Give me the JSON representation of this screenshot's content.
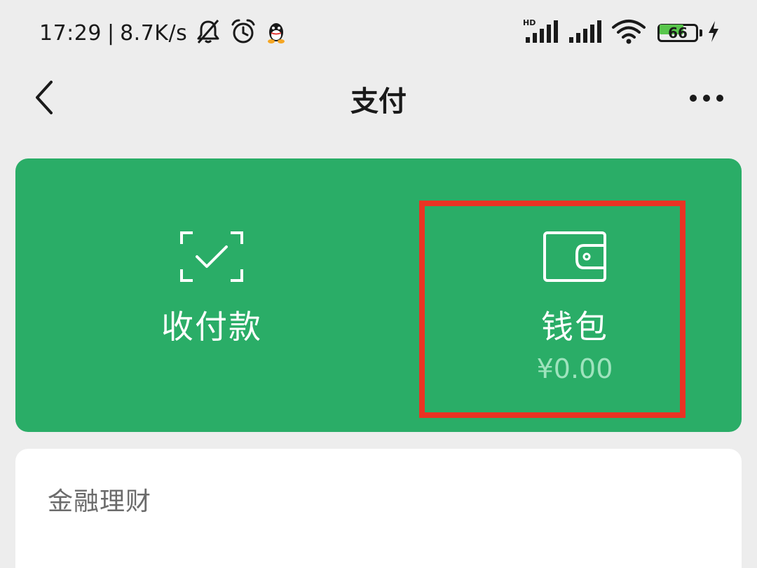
{
  "status_bar": {
    "time": "17:29",
    "separator": "|",
    "net_speed": "8.7K/s",
    "icons": [
      "bell-mute-icon",
      "alarm-icon",
      "qq-icon",
      "hd-signal-icon",
      "signal-icon",
      "wifi-icon",
      "battery-icon",
      "charging-icon"
    ],
    "battery_level": "66"
  },
  "nav": {
    "title": "支付"
  },
  "pay_card": {
    "receive_pay_label": "收付款",
    "wallet_label": "钱包",
    "wallet_balance": "¥0.00"
  },
  "finance": {
    "title": "金融理财"
  },
  "colors": {
    "background": "#ededed",
    "card_green": "#2aad67",
    "highlight_red": "#ea3323",
    "balance_text": "#9ee3bd"
  }
}
